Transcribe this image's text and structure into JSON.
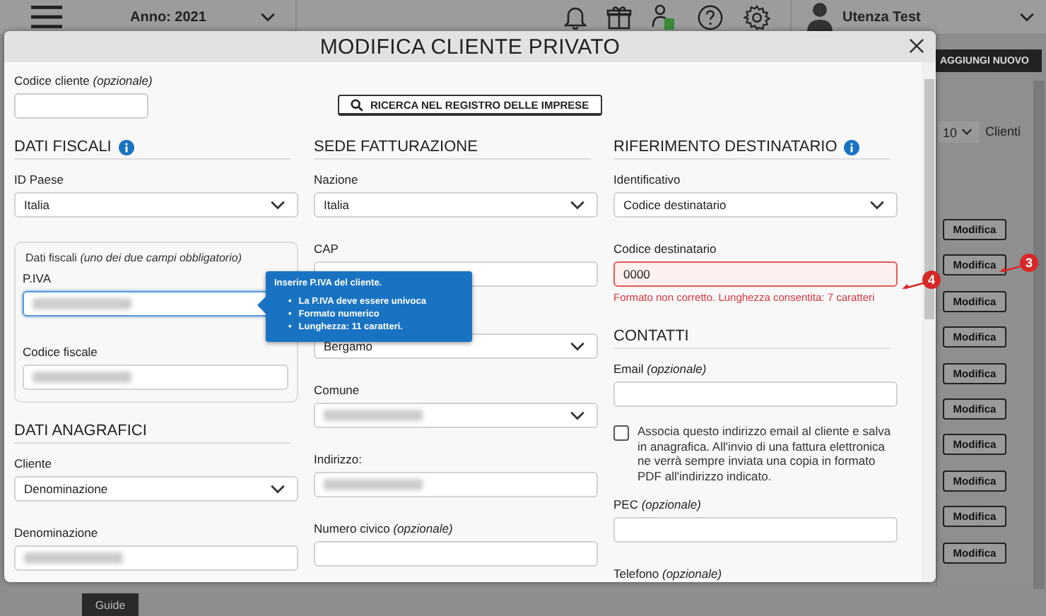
{
  "topbar": {
    "year": "Anno: 2021",
    "user": "Utenza Test"
  },
  "background": {
    "add_button": "AGGIUNGI NUOVO",
    "page_size": "10",
    "page_size_label": "Clienti",
    "row_buttons": [
      "Modifica",
      "Modifica",
      "Modifica",
      "Modifica",
      "Modifica",
      "Modifica",
      "Modifica",
      "Modifica",
      "Modifica",
      "Modifica"
    ],
    "guide_tab": "Guide"
  },
  "modal": {
    "title": "MODIFICA CLIENTE PRIVATO",
    "customer_code": {
      "label": "Codice cliente *(opzionale)*"
    },
    "search_button": "RICERCA NEL REGISTRO DELLE IMPRESE",
    "columns": [
      {
        "items": [
          {
            "kind": "heading",
            "text": "DATI FISCALI",
            "info": true
          },
          {
            "kind": "select",
            "label": "ID Paese",
            "value": "Italia",
            "redacted": false
          },
          {
            "kind": "group",
            "label": "Dati fiscali *(uno dei due campi obbligatorio)*",
            "children": [
              {
                "kind": "input",
                "label": "P.IVA",
                "redacted": true,
                "focused": true,
                "tooltip": {
                  "title": "Inserire P.IVA del cliente.",
                  "bullet": "•",
                  "items": [
                    "La P.IVA deve essere univoca",
                    "Formato numerico",
                    "Lunghezza: 11 caratteri."
                  ]
                }
              },
              {
                "kind": "input",
                "label": "Codice fiscale",
                "redacted": true,
                "focused": false
              }
            ]
          },
          {
            "kind": "heading",
            "text": "DATI ANAGRAFICI",
            "info": false
          },
          {
            "kind": "select",
            "label": "Cliente",
            "value": "Denominazione",
            "redacted": false
          },
          {
            "kind": "input",
            "label": "Denominazione",
            "redacted": true,
            "focused": false
          }
        ]
      },
      {
        "items": [
          {
            "kind": "heading",
            "text": "SEDE FATTURAZIONE",
            "info": false
          },
          {
            "kind": "select",
            "label": "Nazione",
            "value": "Italia",
            "redacted": false
          },
          {
            "kind": "input",
            "label": "CAP",
            "redacted": false,
            "focused": false
          },
          {
            "kind": "select",
            "value": "Bergamo",
            "redacted": false
          },
          {
            "kind": "select",
            "label": "Comune",
            "redacted": true
          },
          {
            "kind": "input",
            "label": "Indirizzo:",
            "redacted": true,
            "focused": false
          },
          {
            "kind": "input",
            "label": "Numero civico *(opzionale)*",
            "redacted": false,
            "focused": false
          }
        ]
      },
      {
        "items": [
          {
            "kind": "heading",
            "text": "RIFERIMENTO DESTINATARIO",
            "info": true
          },
          {
            "kind": "select",
            "label": "Identificativo",
            "value": "Codice destinatario",
            "redacted": false
          },
          {
            "kind": "input",
            "label": "Codice destinatario",
            "value": "0000",
            "redacted": false,
            "focused": false,
            "error": "Formato non corretto. Lunghezza consentita: 7 caratteri"
          },
          {
            "kind": "heading",
            "text": "CONTATTI",
            "info": false
          },
          {
            "kind": "input",
            "label": "Email *(opzionale)*",
            "redacted": false,
            "focused": false
          },
          {
            "kind": "checkbox",
            "label": "Associa questo indirizzo email al cliente e salva in anagrafica. All'invio di una fattura elettronica ne verrà sempre inviata una copia in formato PDF all'indirizzo indicato.",
            "checked": false
          },
          {
            "kind": "input",
            "label": "PEC *(opzionale)*",
            "redacted": false,
            "focused": false
          },
          {
            "kind": "label",
            "label": "Telefono *(opzionale)*"
          }
        ]
      }
    ]
  },
  "annotations": [
    {
      "label": "3"
    },
    {
      "label": "4"
    }
  ]
}
